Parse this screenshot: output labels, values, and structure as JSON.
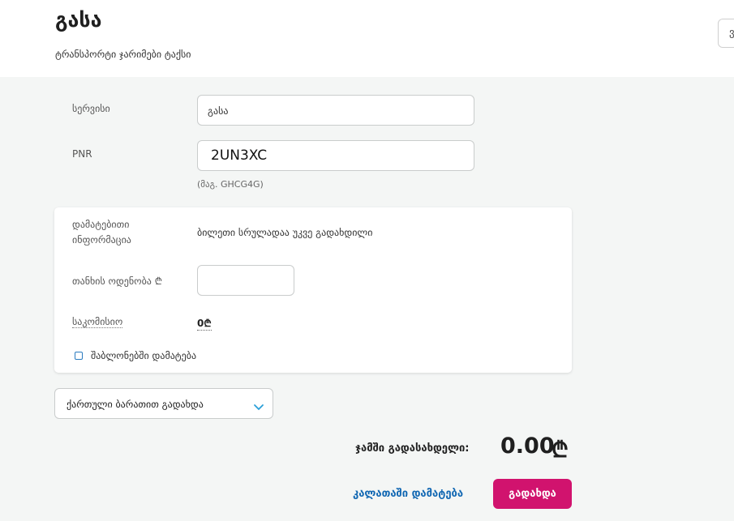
{
  "header": {
    "title": "გასა",
    "subtitle": "ტრანსპორტი ჯარიმები ტაქსი",
    "corner_button_text": "ვ"
  },
  "form": {
    "service_label": "სერვისი",
    "service_value": "გასა",
    "pnr_label": "PNR",
    "pnr_value": "2UN3XC",
    "pnr_hint": "(მაგ. GHCG4G)"
  },
  "details": {
    "info_label_line1": "დამატებითი",
    "info_label_line2": "ინფორმაცია",
    "info_value": "ბილეთი სრულადაა უკვე გადახდილი",
    "amount_label": "თანხის ოდენობა ₾",
    "amount_value": "",
    "commission_label": "საკომისიო",
    "commission_value": "0₾",
    "template_checkbox_label": "შაბლონებში დამატება",
    "template_checked": false
  },
  "payment_method": {
    "selected": "ქართული ბარათით გადახდა"
  },
  "summary": {
    "total_label": "ჯამში გადასახდელი:",
    "total_amount": "0.00",
    "currency_symbol": "₾"
  },
  "actions": {
    "add_to_cart_label": "კალათაში დამატება",
    "pay_label": "გადახდა"
  },
  "colors": {
    "accent_pink": "#d1136e",
    "link_blue": "#1268b3",
    "checkbox_blue": "#2a7bbf"
  }
}
